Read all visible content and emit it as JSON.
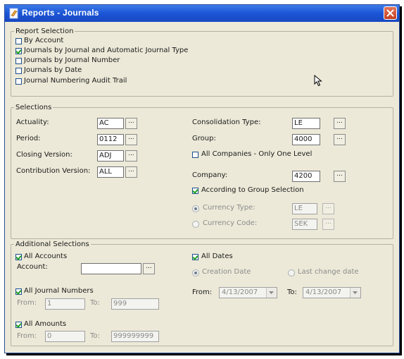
{
  "window": {
    "title": "Reports - Journals"
  },
  "report_selection": {
    "legend": "Report Selection",
    "options": [
      {
        "label": "By Account",
        "checked": false
      },
      {
        "label": "Journals by Journal and Automatic Journal Type",
        "checked": true
      },
      {
        "label": "Journals by Journal Number",
        "checked": false
      },
      {
        "label": "Journals by Date",
        "checked": false
      },
      {
        "label": "Journal Numbering Audit Trail",
        "checked": false
      }
    ]
  },
  "selections": {
    "legend": "Selections",
    "actuality": {
      "label": "Actuality:",
      "value": "AC"
    },
    "period": {
      "label": "Period:",
      "value": "0112"
    },
    "closing_version": {
      "label": "Closing Version:",
      "value": "ADJ"
    },
    "contribution_version": {
      "label": "Contribution Version:",
      "value": "ALL"
    },
    "consolidation_type": {
      "label": "Consolidation Type:",
      "value": "LE"
    },
    "group": {
      "label": "Group:",
      "value": "4000"
    },
    "all_companies": {
      "label": "All Companies - Only One Level",
      "checked": false
    },
    "company": {
      "label": "Company:",
      "value": "4200"
    },
    "according_group": {
      "label": "According to Group Selection",
      "checked": true
    },
    "currency_type": {
      "label": "Currency Type:",
      "value": "LE",
      "selected": true
    },
    "currency_code": {
      "label": "Currency Code:",
      "value": "SEK",
      "selected": false
    },
    "browse_label": "..."
  },
  "additional": {
    "legend": "Additional Selections",
    "all_accounts": {
      "label": "All Accounts",
      "checked": true
    },
    "account": {
      "label": "Account:",
      "value": ""
    },
    "all_journal_numbers": {
      "label": "All Journal Numbers",
      "checked": true
    },
    "journal_from": {
      "label": "From:",
      "value": "1"
    },
    "journal_to": {
      "label": "To:",
      "value": "999"
    },
    "all_amounts": {
      "label": "All Amounts",
      "checked": true
    },
    "amount_from": {
      "label": "From:",
      "value": "0"
    },
    "amount_to": {
      "label": "To:",
      "value": "999999999"
    },
    "all_dates": {
      "label": "All Dates",
      "checked": true
    },
    "creation_date": {
      "label": "Creation Date",
      "selected": true
    },
    "last_change_date": {
      "label": "Last change date",
      "selected": false
    },
    "date_from": {
      "label": "From:",
      "value": "4/13/2007"
    },
    "date_to": {
      "label": "To:",
      "value": "4/13/2007"
    }
  }
}
